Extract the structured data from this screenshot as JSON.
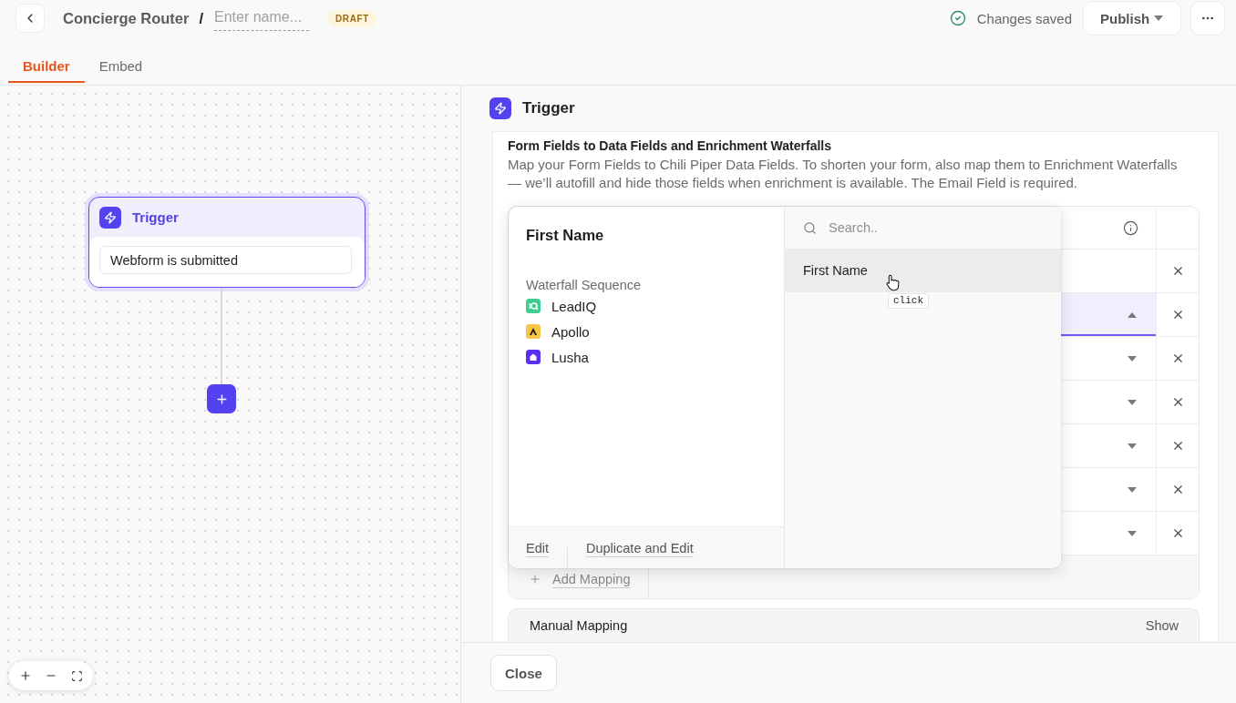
{
  "header": {
    "breadcrumb": "Concierge Router",
    "separator": "/",
    "name_field": {
      "placeholder": "Enter name..."
    },
    "badge": "DRAFT",
    "save_status": "Changes saved",
    "publish_button": "Publish"
  },
  "tabs": [
    {
      "label": "Builder",
      "selected": true
    },
    {
      "label": "Embed",
      "selected": false
    }
  ],
  "canvas": {
    "trigger_node": {
      "title": "Trigger",
      "value": "Webform is submitted",
      "selected": true
    }
  },
  "panel": {
    "title": "Trigger",
    "section": {
      "title": "Form Fields to Data Fields and Enrichment Waterfalls",
      "description": "Map your Form Fields to Chili Piper Data Fields. To shorten your form, also map them to Enrichment Waterfalls — we’ll autofill and hide those fields when enrichment is available. The Email Field is required."
    },
    "mapping_rows": [
      {
        "kind": "text",
        "expanded": false
      },
      {
        "kind": "select",
        "expanded": true
      },
      {
        "kind": "select",
        "expanded": false
      },
      {
        "kind": "select",
        "expanded": false
      },
      {
        "kind": "select",
        "expanded": false
      },
      {
        "kind": "select",
        "expanded": false
      },
      {
        "kind": "select",
        "expanded": false
      }
    ],
    "add_mapping": "Add Mapping",
    "manual_mapping": {
      "label": "Manual Mapping",
      "action": "Show"
    }
  },
  "popover": {
    "title": "First Name",
    "sequence_label": "Waterfall Sequence",
    "providers": [
      {
        "name": "LeadIQ",
        "kind": "ring",
        "color": "#3ecf8e"
      },
      {
        "name": "Apollo",
        "kind": "peak",
        "color": "#f6c544"
      },
      {
        "name": "Lusha",
        "kind": "home",
        "color": "#5a2ff0"
      }
    ],
    "actions": [
      "Edit",
      "Duplicate and Edit"
    ],
    "search": {
      "placeholder": "Search.."
    },
    "options": [
      {
        "label": "First Name",
        "selected": true
      }
    ],
    "cursor_hint": "click"
  },
  "footer": {
    "close_button": "Close"
  }
}
